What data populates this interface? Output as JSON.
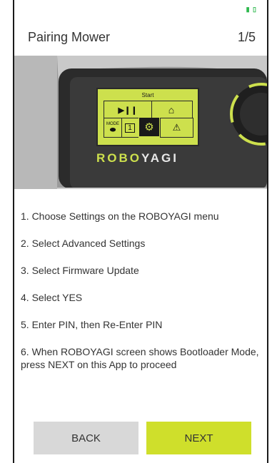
{
  "status": {
    "icon": "battery-icon",
    "icon_glyph": "▮ ▯"
  },
  "header": {
    "title": "Pairing Mower",
    "step": "1/5"
  },
  "device": {
    "screen_title": "Start",
    "screen_colors": {
      "lcd": "#cde04d",
      "frame": "#2a2a2a"
    },
    "icons": {
      "play_pause": "▶❙❙",
      "home": "⌂",
      "mode_label": "MODE",
      "mode_glyph": "⬬",
      "calendar": "📅",
      "calendar_text": "1",
      "settings": "⚙",
      "warning": "⚠"
    },
    "brand_prefix": "ROBO",
    "brand_suffix": "YAGI"
  },
  "instructions": [
    "1. Choose Settings on the ROBOYAGI menu",
    "2. Select Advanced Settings",
    "3. Select Firmware Update",
    "4. Select YES",
    "5. Enter PIN, then Re-Enter PIN",
    "6. When ROBOYAGI screen shows Bootloader Mode, press NEXT on this App to proceed"
  ],
  "buttons": {
    "back": "BACK",
    "next": "NEXT"
  },
  "colors": {
    "accent": "#cfdf2b",
    "secondary": "#d8d8d8",
    "text": "#333333"
  }
}
